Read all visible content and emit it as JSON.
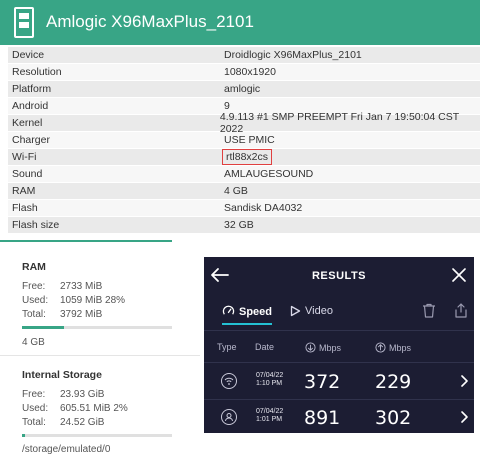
{
  "header": {
    "title": "Amlogic X96MaxPlus_2101",
    "background": "#38a586"
  },
  "spec": [
    {
      "key": "Device",
      "value": "Droidlogic X96MaxPlus_2101"
    },
    {
      "key": "Resolution",
      "value": "1080x1920"
    },
    {
      "key": "Platform",
      "value": "amlogic"
    },
    {
      "key": "Android",
      "value": "9"
    },
    {
      "key": "Kernel",
      "value": "4.9.113 #1 SMP PREEMPT Fri Jan 7 19:50:04 CST 2022"
    },
    {
      "key": "Charger",
      "value": "USE PMIC"
    },
    {
      "key": "Wi-Fi",
      "value": "rtl88x2cs"
    },
    {
      "key": "Sound",
      "value": "AMLAUGESOUND"
    },
    {
      "key": "RAM",
      "value": "4 GB"
    },
    {
      "key": "Flash",
      "value": "Sandisk DA4032"
    },
    {
      "key": "Flash size",
      "value": "32 GB"
    }
  ],
  "ram": {
    "title": "RAM",
    "free_label": "Free:",
    "free": "2733 MiB",
    "used_label": "Used:",
    "used": "1059 MiB 28%",
    "total_label": "Total:",
    "total": "3792 MiB",
    "used_fraction": 0.28,
    "size": "4 GB"
  },
  "storage": {
    "title": "Internal Storage",
    "free_label": "Free:",
    "free": "23.93 GiB",
    "used_label": "Used:",
    "used": "605.51 MiB 2%",
    "total_label": "Total:",
    "total": "24.52 GiB",
    "used_fraction": 0.02,
    "path": "/storage/emulated/0"
  },
  "results": {
    "title": "RESULTS",
    "tab_speed": "Speed",
    "tab_video": "Video",
    "col_type": "Type",
    "col_date": "Date",
    "col_download": "Mbps",
    "col_upload": "Mbps",
    "accent": "#24c1d4",
    "rows": [
      {
        "type_icon": "wifi-icon",
        "date": "07/04/22",
        "time": "1:10 PM",
        "download": "372",
        "upload": "229"
      },
      {
        "type_icon": "user-icon",
        "date": "07/04/22",
        "time": "1:01 PM",
        "download": "891",
        "upload": "302"
      }
    ]
  }
}
